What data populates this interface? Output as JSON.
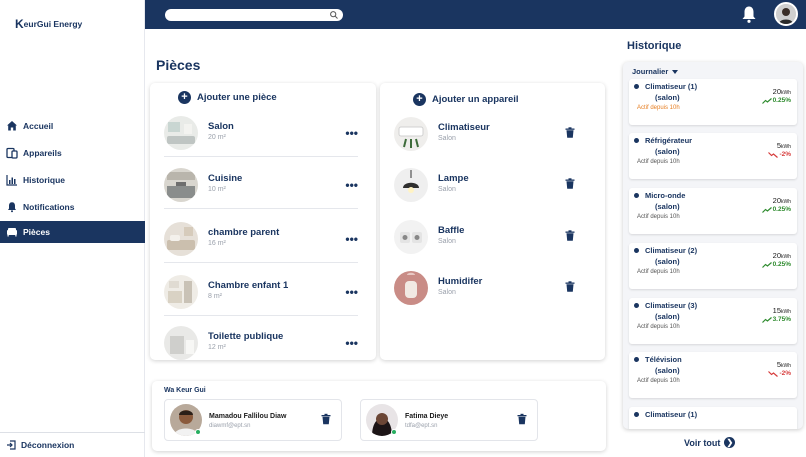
{
  "brand": {
    "name": "eurGui Energy",
    "initial": "K"
  },
  "sidebar": {
    "items": [
      {
        "label": "Accueil",
        "icon": "home-icon"
      },
      {
        "label": "Appareils",
        "icon": "device-icon"
      },
      {
        "label": "Historique",
        "icon": "chart-icon"
      },
      {
        "label": "Notifications",
        "icon": "bell-icon"
      },
      {
        "label": "Pièces",
        "icon": "room-icon",
        "active": true
      }
    ],
    "logout": "Déconnexion"
  },
  "page": {
    "title": "Pièces"
  },
  "rooms": {
    "add_label": "Ajouter une pièce",
    "items": [
      {
        "name": "Salon",
        "area": "20 m²"
      },
      {
        "name": "Cuisine",
        "area": "10 m²"
      },
      {
        "name": "chambre parent",
        "area": "16 m²"
      },
      {
        "name": "Chambre enfant 1",
        "area": "8 m²"
      },
      {
        "name": "Toilette publique",
        "area": "12 m²"
      }
    ],
    "more_label": "•••"
  },
  "devices": {
    "add_label": "Ajouter un appareil",
    "items": [
      {
        "name": "Climatiseur",
        "room": "Salon"
      },
      {
        "name": "Lampe",
        "room": "Salon"
      },
      {
        "name": "Baffle",
        "room": "Salon"
      },
      {
        "name": "Humidifer",
        "room": "Salon"
      }
    ]
  },
  "team": {
    "title": "Wa Keur Gui",
    "members": [
      {
        "name": "Mamadou Fallilou Diaw",
        "email": "diawmf@ept.sn"
      },
      {
        "name": "Fatima Dieye",
        "email": "tdfa@ept.sn"
      }
    ]
  },
  "history": {
    "title": "Historique",
    "filter": "Journalier",
    "unit": "kWh",
    "items": [
      {
        "name": "Climatiseur (1)",
        "location": "(salon)",
        "status": "Actif depuis 10h",
        "status_color": "#e67e22",
        "value": "20",
        "trend": "0.25%",
        "direction": "up"
      },
      {
        "name": "Réfrigérateur",
        "location": "(salon)",
        "status": "Actif depuis 10h",
        "value": "5",
        "trend": "-2%",
        "direction": "down"
      },
      {
        "name": "Micro-onde",
        "location": "(salon)",
        "status": "Actif depuis 10h",
        "value": "20",
        "trend": "0.25%",
        "direction": "up"
      },
      {
        "name": "Climatiseur (2)",
        "location": "(salon)",
        "status": "Actif depuis 10h",
        "value": "20",
        "trend": "0.25%",
        "direction": "up"
      },
      {
        "name": "Climatiseur (3)",
        "location": "(salon)",
        "status": "Actif depuis 10h",
        "value": "15",
        "trend": "3.75%",
        "direction": "up"
      },
      {
        "name": "Télévision",
        "location": "(salon)",
        "status": "Actif depuis 10h",
        "value": "5",
        "trend": "-2%",
        "direction": "down"
      },
      {
        "name": "Climatiseur (1)",
        "location": "",
        "status": "",
        "value": "",
        "trend": "",
        "direction": ""
      }
    ],
    "see_all": "Voir tout"
  },
  "colors": {
    "primary": "#1a3560",
    "accent_up": "#2e8b2e",
    "accent_down": "#d63b3b",
    "online": "#27ae60"
  }
}
